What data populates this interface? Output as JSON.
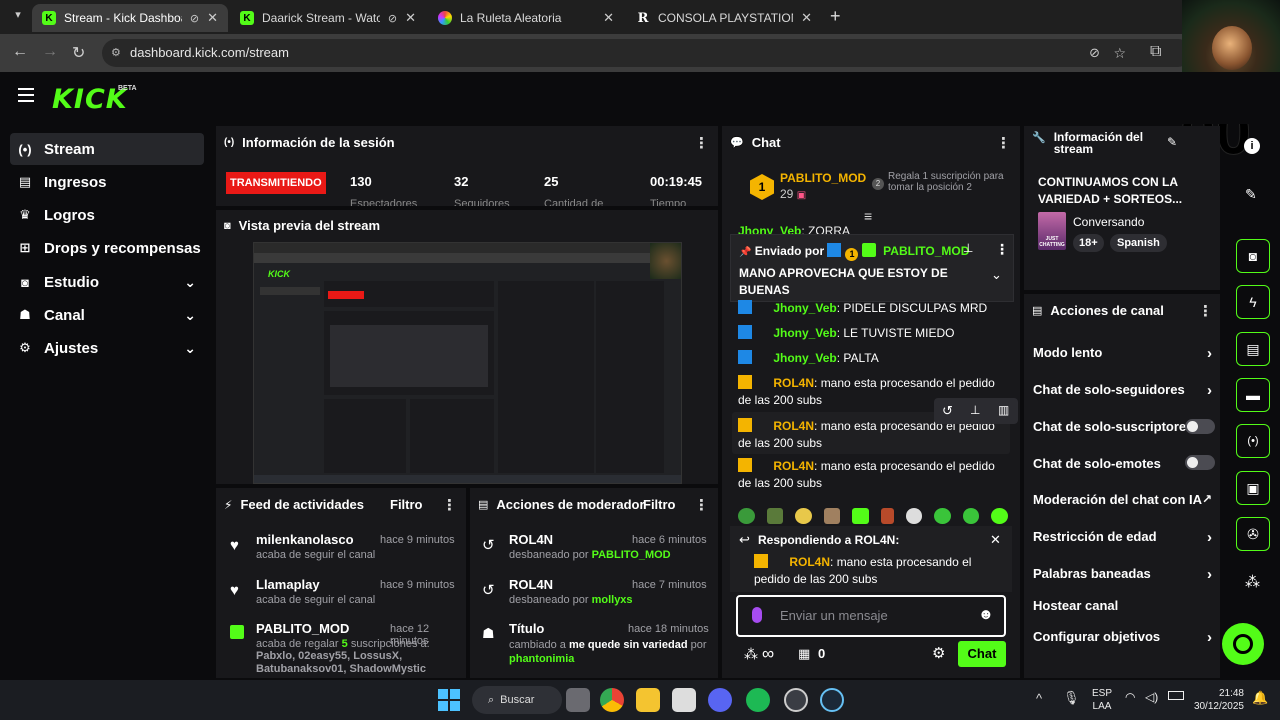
{
  "browser": {
    "tabs": [
      {
        "title": "Stream - Kick Dashboard",
        "favicon": "kick-icon",
        "active": true
      },
      {
        "title": "Daarick Stream - Watch Live",
        "favicon": "kick-icon",
        "active": false
      },
      {
        "title": "La Ruleta Aleatoria",
        "favicon": "wheel-icon",
        "active": false
      },
      {
        "title": "CONSOLA PLAYSTATION 5 SLIM",
        "favicon": "r-icon",
        "active": false
      }
    ],
    "url": "dashboard.kick.com/stream"
  },
  "header": {
    "logo": "KICK",
    "beta": "BETA"
  },
  "sidebar": {
    "items": [
      {
        "label": "Stream",
        "icon": "broadcast-icon",
        "active": true
      },
      {
        "label": "Ingresos",
        "icon": "chart-icon"
      },
      {
        "label": "Logros",
        "icon": "trophy-icon"
      },
      {
        "label": "Drops y recompensas",
        "icon": "gift-icon"
      },
      {
        "label": "Estudio",
        "icon": "camera-icon",
        "expandable": true
      },
      {
        "label": "Canal",
        "icon": "users-icon",
        "expandable": true
      },
      {
        "label": "Ajustes",
        "icon": "gear-icon",
        "expandable": true
      }
    ]
  },
  "session": {
    "title": "Información de la sesión",
    "status": "TRANSMITIENDO",
    "stats": [
      {
        "value": "130",
        "label": "Espectadores"
      },
      {
        "value": "32",
        "label": "Seguidores"
      },
      {
        "value": "25",
        "label": "Cantidad de"
      },
      {
        "value": "00:19:45",
        "label": "Tiempo"
      }
    ]
  },
  "preview": {
    "title": "Vista previa del stream"
  },
  "activity": {
    "title": "Feed de actividades",
    "filter": "Filtro",
    "items": [
      {
        "name": "milenkanolasco",
        "desc": "acaba de seguir el canal",
        "time": "hace 9 minutos",
        "icon": "heart-icon"
      },
      {
        "name": "Llamaplay",
        "desc": "acaba de seguir el canal",
        "time": "hace 9 minutos",
        "icon": "heart-icon"
      },
      {
        "name": "PABLITO_MOD",
        "desc": "acaba de regalar",
        "count": "5",
        "desc2": "suscripciones a:",
        "recipients": "Pabxlo, 02easy55, LossusX, Batubanaksov01, ShadowMystic",
        "time": "hace 12 minutos",
        "icon": "gift-icon"
      }
    ]
  },
  "modactions": {
    "title": "Acciones de moderador",
    "filter": "Filtro",
    "items": [
      {
        "name": "ROL4N",
        "desc": "desbaneado por",
        "by": "PABLITO_MOD",
        "time": "hace 6 minutos",
        "icon": "undo-icon"
      },
      {
        "name": "ROL4N",
        "desc": "desbaneado por",
        "by": "mollyxs",
        "time": "hace 7 minutos",
        "icon": "undo-icon"
      },
      {
        "name": "Título",
        "desc": "cambiado a",
        "bold": "me quede sin variedad",
        "desc2": "por",
        "by": "phantonimia",
        "time": "hace 18 minutos",
        "icon": "title-icon"
      }
    ]
  },
  "chat": {
    "title": "Chat",
    "top_gifter": {
      "rank": "1",
      "name": "PABLITO_MOD",
      "count": "29",
      "cta": "Regala 1 suscripción para tomar la posición 2",
      "cta_rank": "2"
    },
    "clipped_msg": {
      "user": "Jhony_Veb",
      "text": "ZORRA"
    },
    "pinned": {
      "prefix": "Enviado por",
      "badge": "1",
      "user": "PABLITO_MOD",
      "text": "MANO APROVECHA QUE ESTOY DE BUENAS"
    },
    "messages": [
      {
        "user": "Jhony_Veb",
        "text": "PIDELE DISCULPAS MRD"
      },
      {
        "user": "Jhony_Veb",
        "text": "LE TUVISTE MIEDO"
      },
      {
        "user": "Jhony_Veb",
        "text": "PALTA"
      },
      {
        "user": "ROL4N",
        "text": "mano esta procesando el pedido de las 200 subs"
      },
      {
        "user": "ROL4N",
        "text": "mano esta procesando el pedido de las 200 subs"
      },
      {
        "user": "ROL4N",
        "text": "mano esta procesando el pedido de las 200 subs"
      }
    ],
    "reply": {
      "label": "Respondiendo a ROL4N:",
      "user": "ROL4N",
      "text": "mano esta procesando el pedido de las 200 subs"
    },
    "input_placeholder": "Enviar un mensaje",
    "footer": {
      "infinity": "∞",
      "count": "0",
      "send": "Chat"
    }
  },
  "stream_info": {
    "title": "Información del stream",
    "stream_title": "CONTINUAMOS CON LA VARIEDAD + SORTEOS...",
    "category": "Conversando",
    "thumb_label": "JUST CHATTING",
    "tags": [
      "18+",
      "Spanish"
    ]
  },
  "channel_actions": {
    "title": "Acciones de canal",
    "items": [
      {
        "label": "Modo lento",
        "kind": "chevron"
      },
      {
        "label": "Chat de solo-seguidores",
        "kind": "chevron"
      },
      {
        "label": "Chat de solo-suscriptores",
        "kind": "toggle"
      },
      {
        "label": "Chat de solo-emotes",
        "kind": "toggle"
      },
      {
        "label": "Moderación del chat con IA",
        "kind": "external"
      },
      {
        "label": "Restricción de edad",
        "kind": "chevron"
      },
      {
        "label": "Palabras baneadas",
        "kind": "chevron"
      },
      {
        "label": "Hostear canal",
        "kind": "none"
      },
      {
        "label": "Configurar objetivos",
        "kind": "chevron"
      }
    ]
  },
  "overlay_text": "00",
  "taskbar": {
    "search": "Buscar",
    "lang": "ESP",
    "lang2": "LAA",
    "time": "21:48",
    "date": "30/12/2025"
  },
  "colors": {
    "accent": "#53fc18",
    "live": "#e91916",
    "panel": "#18181b",
    "bg": "#0b0b0d"
  }
}
